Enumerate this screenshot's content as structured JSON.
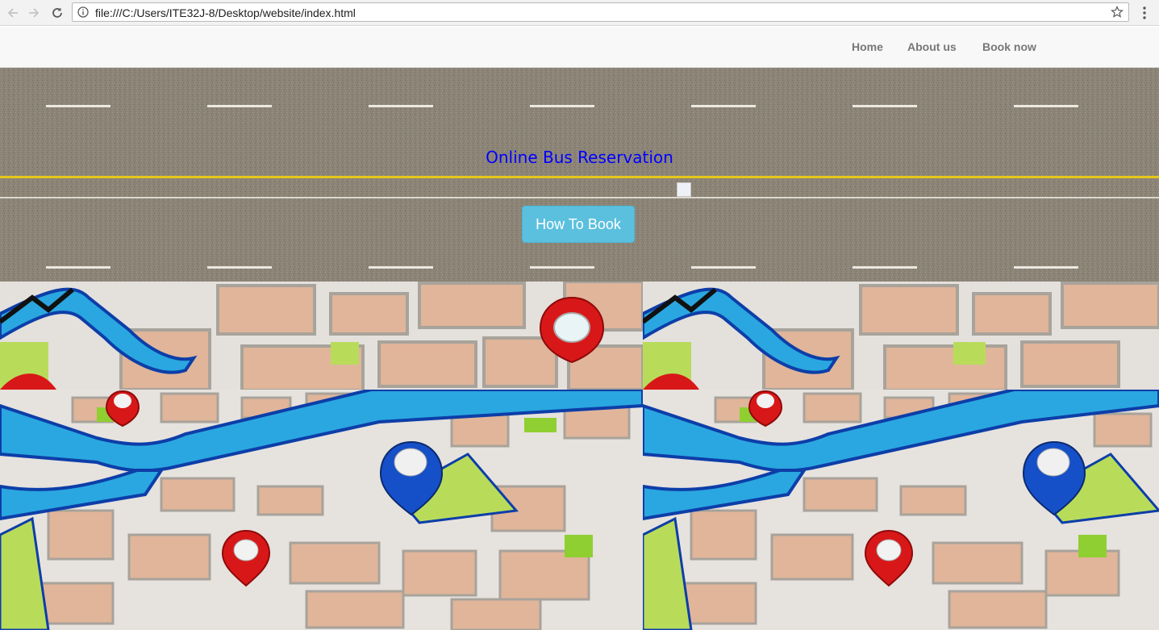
{
  "browser": {
    "url": "file:///C:/Users/ITE32J-8/Desktop/website/index.html",
    "icons": [
      "back-arrow-icon",
      "forward-arrow-icon",
      "reload-icon",
      "info-icon",
      "star-icon",
      "menu-dots-icon"
    ]
  },
  "nav": {
    "items": [
      {
        "label": "Home"
      },
      {
        "label": "About us"
      },
      {
        "label": "Book now"
      }
    ]
  },
  "hero": {
    "title": "Online Bus Reservation",
    "button_label": "How To Book",
    "title_color": "#0000ff",
    "button_color": "#5bc0de"
  },
  "maps": {
    "tiles": [
      {
        "icon": "map-pin-icon"
      },
      {
        "icon": "map-pin-icon"
      },
      {
        "icon": "map-pin-icon"
      },
      {
        "icon": "map-pin-icon"
      }
    ]
  },
  "colors": {
    "road": "#8c8577",
    "lane_yellow": "#e6c71a",
    "map_water": "#2aa7e0",
    "map_block": "#e0b59a",
    "pin_red": "#d81818",
    "pin_blue": "#1650c8"
  }
}
